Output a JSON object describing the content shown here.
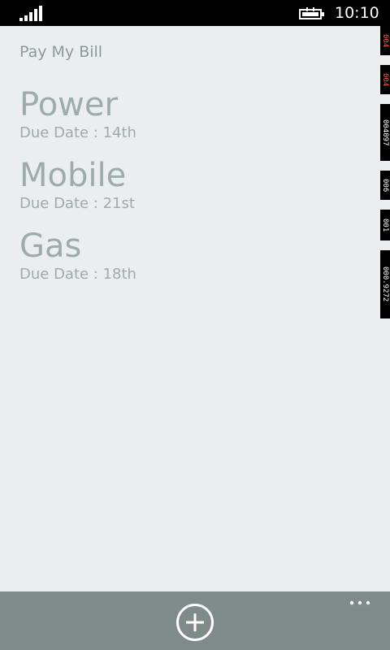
{
  "status_bar": {
    "time": "10:10",
    "signal_icon": "signal-strength-icon",
    "battery_icon": "battery-charging-icon"
  },
  "app": {
    "title": "Pay My Bill"
  },
  "bills": [
    {
      "name": "Power",
      "due": "Due Date : 14th"
    },
    {
      "name": "Mobile",
      "due": "Due Date : 21st"
    },
    {
      "name": "Gas",
      "due": "Due Date : 18th"
    }
  ],
  "debug_counters": [
    {
      "value": "004",
      "color": "#ff5a3c"
    },
    {
      "value": "004",
      "color": "#ff5a3c"
    },
    {
      "value": "004097",
      "color": "#ffffff"
    },
    {
      "value": "006",
      "color": "#ffffff"
    },
    {
      "value": "001",
      "color": "#ffffff"
    },
    {
      "value": "000.9272",
      "color": "#ffffff"
    }
  ],
  "app_bar": {
    "add_icon": "add-circle-icon",
    "more_icon": "ellipsis-icon"
  },
  "colors": {
    "background": "#ebeeef",
    "text": "#9eaca9",
    "app_bar": "#7e8b89",
    "status_bar": "#000000"
  }
}
